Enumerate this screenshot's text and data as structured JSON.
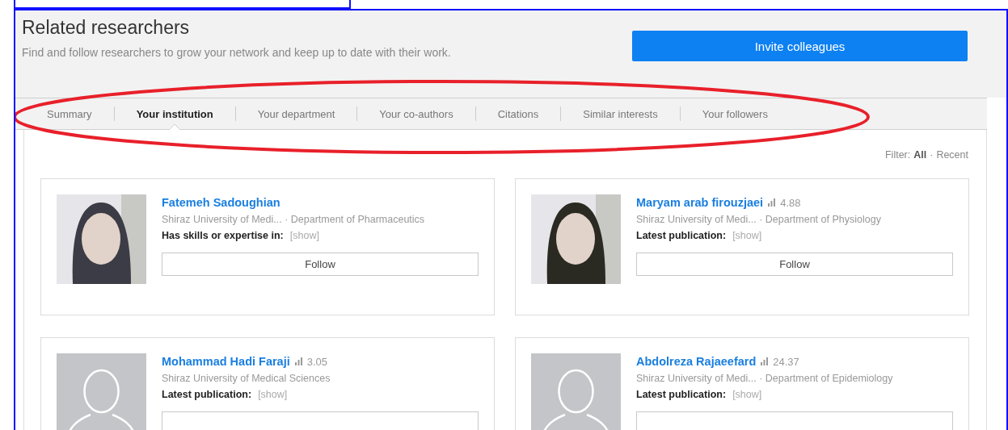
{
  "header": {
    "title": "Related researchers",
    "subtitle": "Find and follow researchers to grow your network and keep up to date with their work.",
    "invite_button": "Invite colleagues"
  },
  "tabs": [
    {
      "label": "Summary",
      "selected": false
    },
    {
      "label": "Your institution",
      "selected": true
    },
    {
      "label": "Your department",
      "selected": false
    },
    {
      "label": "Your co-authors",
      "selected": false
    },
    {
      "label": "Citations",
      "selected": false
    },
    {
      "label": "Similar interests",
      "selected": false
    },
    {
      "label": "Your followers",
      "selected": false
    }
  ],
  "filter": {
    "label": "Filter:",
    "separator": "·",
    "options": [
      {
        "label": "All",
        "selected": true
      },
      {
        "label": "Recent",
        "selected": false
      }
    ]
  },
  "researchers": [
    {
      "name": "Fatemeh Sadoughian",
      "affiliation": "Shiraz University of Medi... · Department of Pharmaceutics",
      "detail_label": "Has skills or expertise in:",
      "detail_link": "[show]",
      "follow": "Follow"
    },
    {
      "name": "Maryam arab firouzjaei",
      "score": "4.88",
      "affiliation": "Shiraz University of Medi... · Department of Physiology",
      "detail_label": "Latest publication:",
      "detail_link": "[show]",
      "follow": "Follow"
    },
    {
      "name": "Mohammad Hadi Faraji",
      "score": "3.05",
      "affiliation": "Shiraz University of Medical Sciences",
      "detail_label": "Latest publication:",
      "detail_link": "[show]",
      "photo": {
        "kind": "placeholder"
      }
    },
    {
      "name": "Abdolreza Rajaeefard",
      "score": "24.37",
      "affiliation": "Shiraz University of Medi... · Department of Epidemiology",
      "detail_label": "Latest publication:",
      "detail_link": "[show]",
      "photo": {
        "kind": "placeholder"
      }
    }
  ]
}
